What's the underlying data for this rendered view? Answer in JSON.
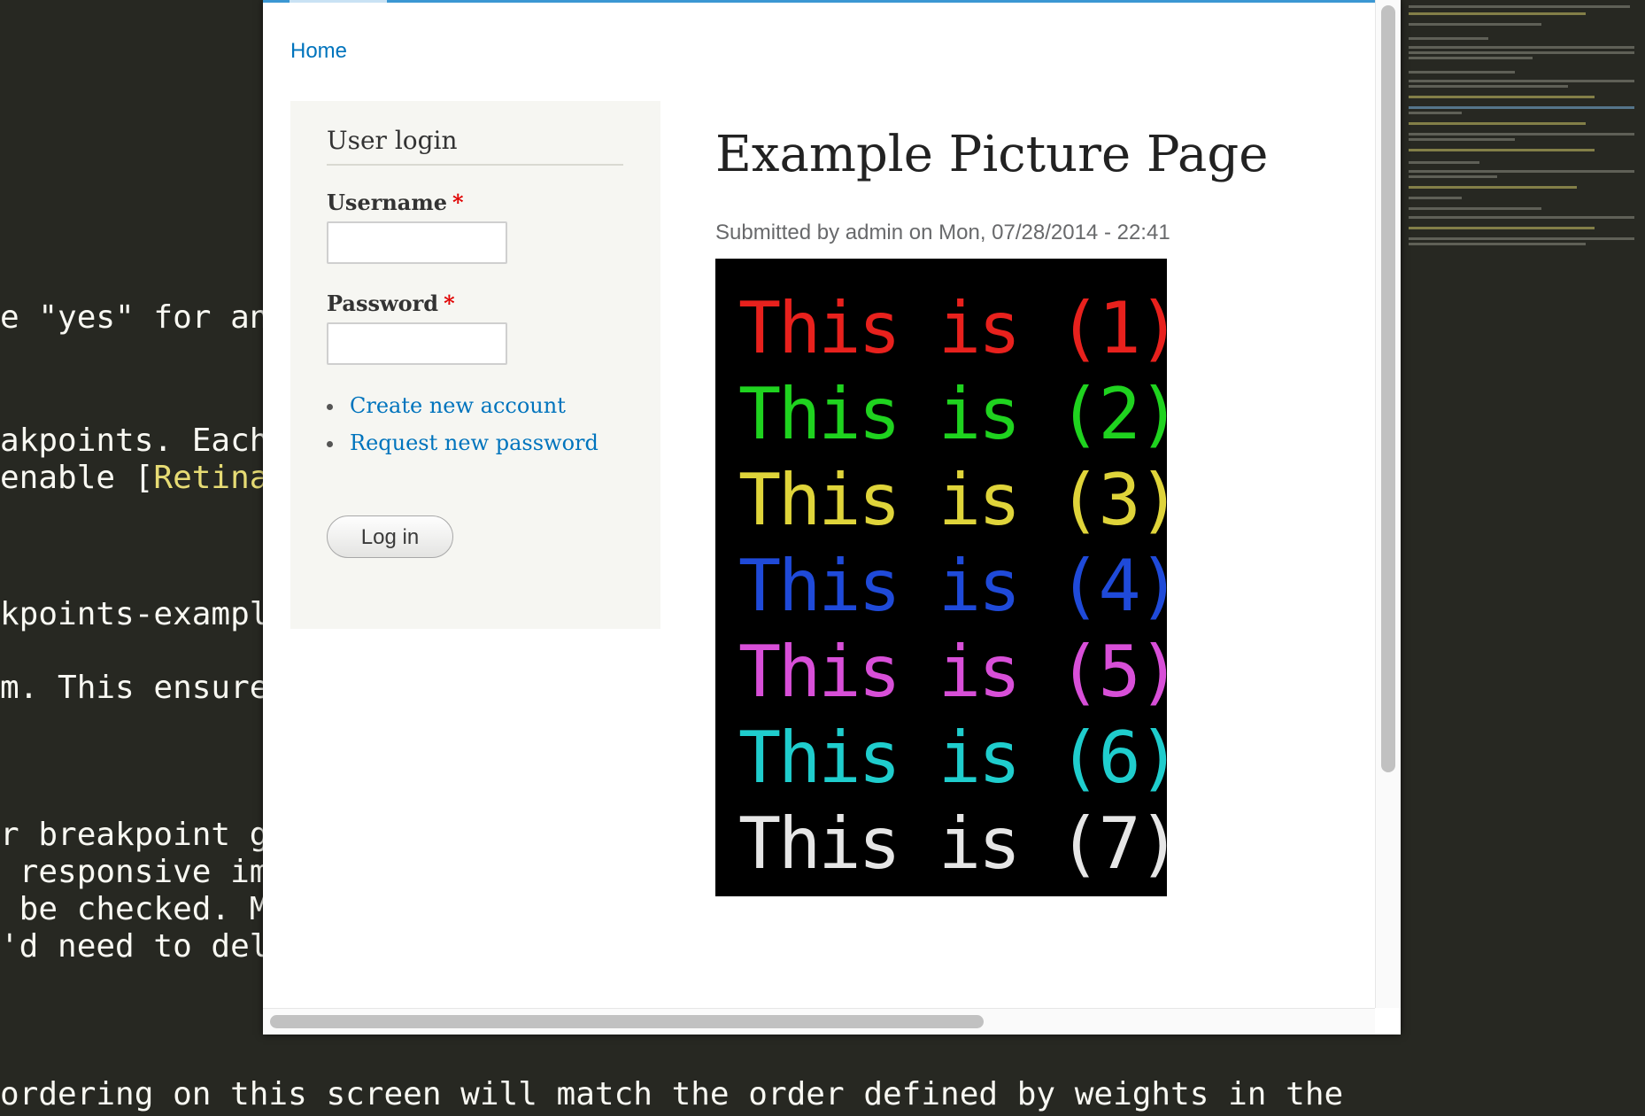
{
  "editor": {
    "lines": [
      {
        "text": "e \"yes\" for any",
        "highlight": ""
      },
      {
        "text": "akpoints. Each",
        "highlight": ""
      },
      {
        "text": "enable [",
        "highlight": "Retina"
      },
      {
        "text": "kpoints-example",
        "highlight": ""
      },
      {
        "text": "m. This ensures",
        "highlight": ""
      },
      {
        "text": "r breakpoint gr",
        "highlight": ""
      },
      {
        "text": " responsive ima",
        "highlight": ""
      },
      {
        "text": " be checked. Ma",
        "highlight": ""
      },
      {
        "text": "'d need to dele",
        "highlight": ""
      },
      {
        "text": "ordering on this screen will match the order defined by weights in the",
        "highlight": ""
      }
    ]
  },
  "browser": {
    "nav": {
      "home_label": "Home"
    },
    "sidebar": {
      "title": "User login",
      "username_label": "Username",
      "password_label": "Password",
      "required_marker": "*",
      "links": [
        "Create new account",
        "Request new password"
      ],
      "login_button": "Log in"
    },
    "content": {
      "title": "Example Picture Page",
      "submitted": "Submitted by admin on Mon, 07/28/2014 - 22:41",
      "picture": {
        "lines": [
          {
            "text": "This is (1)",
            "color": "#e8211d"
          },
          {
            "text": "This is (2)",
            "color": "#1fd31f"
          },
          {
            "text": "This is (3)",
            "color": "#dfd43a"
          },
          {
            "text": "This is (4)",
            "color": "#1f4ad9"
          },
          {
            "text": "This is (5)",
            "color": "#d84fd8"
          },
          {
            "text": "This is (6)",
            "color": "#1fcdcd"
          },
          {
            "text": "This is (7)",
            "color": "#e6e6e6"
          }
        ]
      }
    }
  },
  "colors": {
    "link": "#0074bd",
    "accent": "#3b97d3",
    "editor_bg": "#272822"
  }
}
